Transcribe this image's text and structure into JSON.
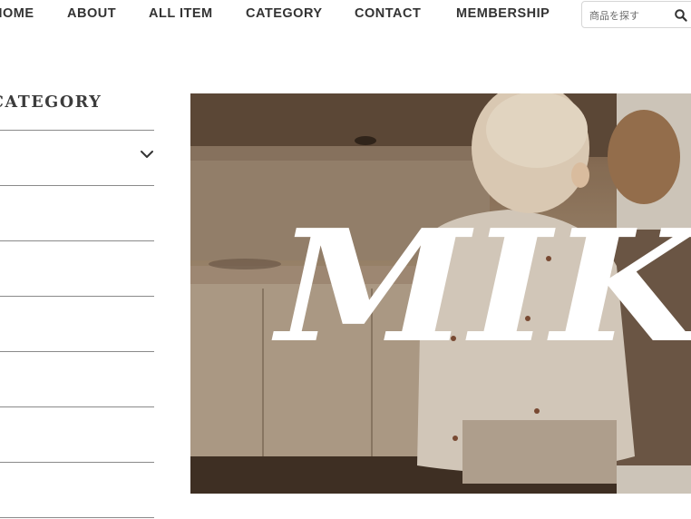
{
  "nav": {
    "items": [
      "HOME",
      "ABOUT",
      "ALL ITEM",
      "CATEGORY",
      "CONTACT",
      "MEMBERSHIP"
    ],
    "search_placeholder": "商品を探す"
  },
  "sidebar": {
    "heading": "CATEGORY",
    "rows": [
      "",
      "",
      "",
      "",
      "",
      "",
      ""
    ]
  },
  "hero": {
    "brand_text": "MIK"
  },
  "colors": {
    "text": "#333333",
    "divider": "#8a8a8a",
    "hero_brand": "#ffffff"
  }
}
